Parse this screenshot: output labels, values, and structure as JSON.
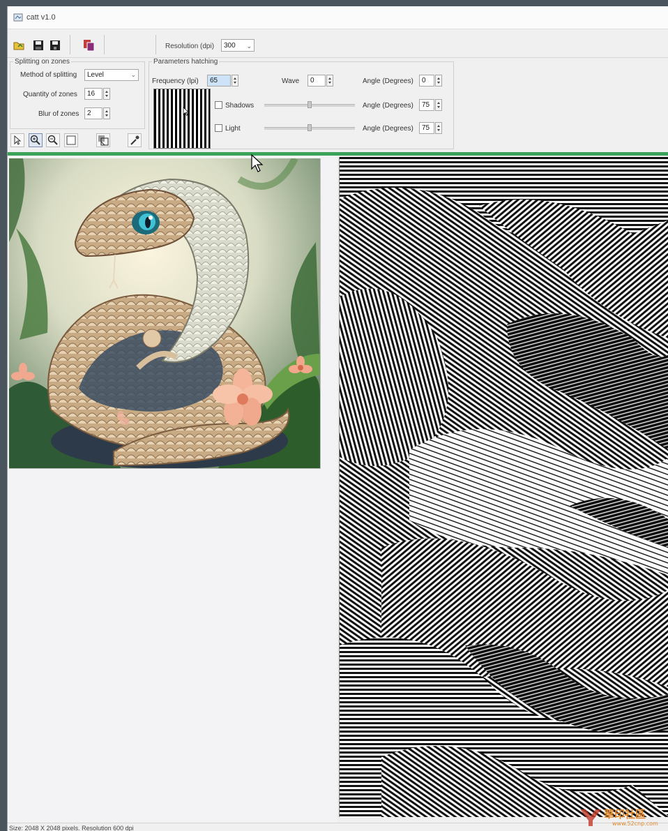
{
  "window": {
    "title": "catt v1.0"
  },
  "toolbar": {
    "buttons": [
      {
        "name": "open-icon",
        "color": "#c8a020"
      },
      {
        "name": "save-icon",
        "color": "#2a2a2a"
      },
      {
        "name": "save-all-icon",
        "color": "#2a2a2a"
      },
      {
        "name": "copy-image-icon",
        "color": "#b03030"
      }
    ],
    "resolution_label": "Resolution (dpi)",
    "resolution_value": "300"
  },
  "splitting": {
    "legend": "Splitting on zones",
    "method_label": "Method of splitting",
    "method_value": "Level",
    "quantity_label": "Quantity of zones",
    "quantity_value": "16",
    "blur_label": "Blur of zones",
    "blur_value": "2"
  },
  "tools": [
    {
      "name": "pointer-icon"
    },
    {
      "name": "zoom-in-icon"
    },
    {
      "name": "zoom-out-icon"
    },
    {
      "name": "fit-icon"
    },
    {
      "name": "zones-icon"
    },
    {
      "name": "eyedropper-icon"
    }
  ],
  "hatching": {
    "legend": "Parameters hatching",
    "frequency_label": "Frequency (lpi)",
    "frequency_value": "65",
    "wave_label": "Wave",
    "wave_value": "0",
    "angle_label": "Angle (Degrees)",
    "angle_value": "0",
    "shadows_label": "Shadows",
    "shadows_checked": false,
    "shadows_angle_label": "Angle (Degrees)",
    "shadows_angle_value": "75",
    "light_label": "Light",
    "light_checked": false,
    "light_angle_label": "Angle (Degrees)",
    "light_angle_value": "75"
  },
  "accent_color": "#3aa35a",
  "status": {
    "text": "Size: 2048 X 2048 pixels. Resolution 600 dpi"
  },
  "watermark": {
    "text": "華印社區",
    "url": "www.52cnp.com"
  }
}
